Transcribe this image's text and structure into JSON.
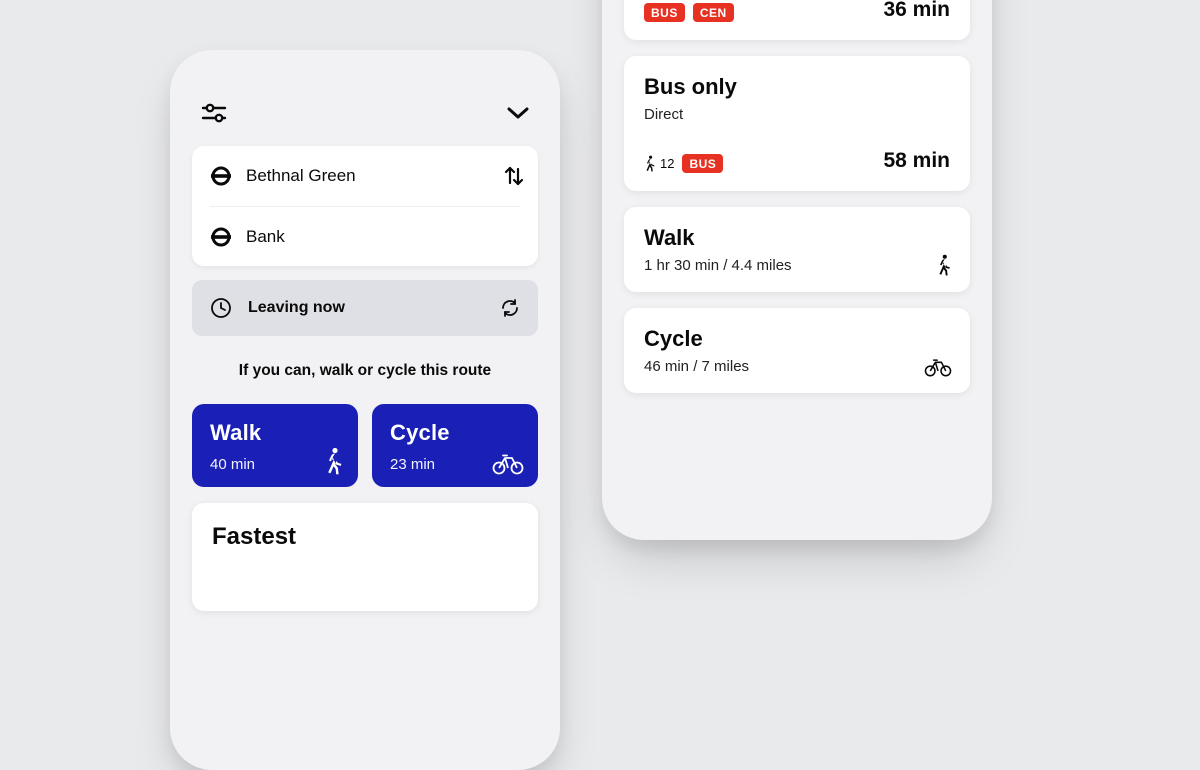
{
  "left": {
    "from": "Bethnal Green",
    "to": "Bank",
    "leaving_label": "Leaving now",
    "advice": "If you can, walk or cycle this route",
    "walk": {
      "title": "Walk",
      "time": "40 min"
    },
    "cycle": {
      "title": "Cycle",
      "time": "23 min"
    },
    "fastest_heading": "Fastest"
  },
  "right": {
    "top_route": {
      "pills": [
        "BUS",
        "CEN"
      ],
      "time": "36 min"
    },
    "bus_only": {
      "title": "Bus only",
      "subtitle": "Direct",
      "walk_minutes": "12",
      "pills": [
        "BUS"
      ],
      "time": "58 min"
    },
    "walk": {
      "title": "Walk",
      "subtitle": "1 hr 30 min / 4.4 miles"
    },
    "cycle": {
      "title": "Cycle",
      "subtitle": "46 min / 7 miles"
    }
  }
}
